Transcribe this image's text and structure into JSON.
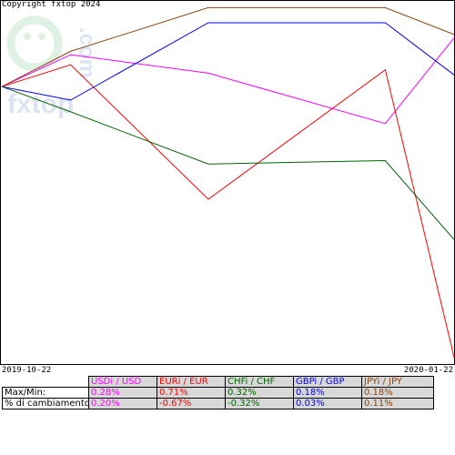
{
  "copyright": "Copyright fxtop 2024",
  "logo_text": "fxtop.com",
  "dates": {
    "start": "2019-10-22",
    "end": "2020-01-22"
  },
  "chart_data": {
    "type": "line",
    "x": [
      "2019-10-22",
      "2019-11-05",
      "2019-12-03",
      "2020-01-08",
      "2020-01-22"
    ],
    "series": [
      {
        "name": "USDi / USD",
        "color": "#ff00ff",
        "values": [
          0.135,
          0.23,
          0.175,
          0.025,
          0.28
        ]
      },
      {
        "name": "EURi / EUR",
        "color": "#ff0000",
        "values": [
          0.135,
          0.2,
          -0.2,
          0.185,
          -0.67
        ]
      },
      {
        "name": "CHFi / CHF",
        "color": "#006400",
        "values": [
          0.135,
          0.06,
          -0.095,
          -0.085,
          -0.32
        ]
      },
      {
        "name": "GBPi / GBP",
        "color": "#0000ff",
        "values": [
          0.135,
          0.095,
          0.325,
          0.325,
          0.17
        ]
      },
      {
        "name": "JPYi / JPY",
        "color": "#8b4513",
        "values": [
          0.135,
          0.24,
          0.37,
          0.37,
          0.29
        ]
      }
    ],
    "ylim": [
      -0.69,
      0.39
    ],
    "grid": false,
    "legend": "table-bottom"
  },
  "table": {
    "row_labels": [
      "Max/Min:",
      "% di cambiamento:"
    ],
    "columns": [
      {
        "label": "USDi / USD",
        "color": "#ff00ff",
        "maxmin": "0.28%",
        "change": "0.20%"
      },
      {
        "label": "EURi / EUR",
        "color": "#ff0000",
        "maxmin": "0.71%",
        "change": "-0.67%"
      },
      {
        "label": "CHFi / CHF",
        "color": "#006400",
        "maxmin": "0.32%",
        "change": "-0.32%"
      },
      {
        "label": "GBPi / GBP",
        "color": "#0000ff",
        "maxmin": "0.18%",
        "change": "0.03%"
      },
      {
        "label": "JPYi / JPY",
        "color": "#8b4513",
        "maxmin": "0.18%",
        "change": "0.11%"
      }
    ]
  }
}
